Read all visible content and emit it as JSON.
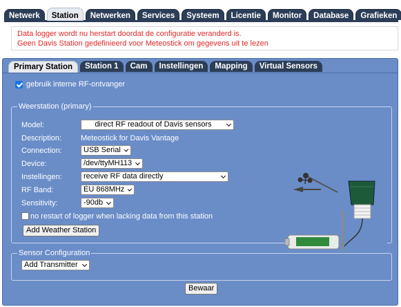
{
  "top_tabs": [
    {
      "label": "Netwerk",
      "active": false
    },
    {
      "label": "Station",
      "active": true
    },
    {
      "label": "Netwerken",
      "active": false
    },
    {
      "label": "Services",
      "active": false
    },
    {
      "label": "Systeem",
      "active": false
    },
    {
      "label": "Licentie",
      "active": false
    },
    {
      "label": "Monitor",
      "active": false
    },
    {
      "label": "Database",
      "active": false
    },
    {
      "label": "Grafieken",
      "active": false
    }
  ],
  "alert": {
    "line1": "Data logger wordt nu herstart doordat de configuratie veranderd is.",
    "line2": "Geen Davis Station gedefinieerd voor Meteostick om gegevens uit te lezen"
  },
  "sub_tabs": [
    {
      "label": "Primary Station",
      "active": true
    },
    {
      "label": "Station 1",
      "active": false
    },
    {
      "label": "Cam",
      "active": false
    },
    {
      "label": "Instellingen",
      "active": false
    },
    {
      "label": "Mapping",
      "active": false
    },
    {
      "label": "Virtual Sensors",
      "active": false
    }
  ],
  "rf_checkbox": {
    "label": "gebruik interne RF-ontvanger",
    "checked": true
  },
  "weather_station": {
    "legend": "Weerstation (primary)",
    "model": {
      "label": "Model:",
      "value": "direct RF readout of Davis sensors"
    },
    "description": {
      "label": "Description:",
      "value": "Meteostick for Davis Vantage"
    },
    "connection": {
      "label": "Connection:",
      "value": "USB Serial"
    },
    "device": {
      "label": "Device:",
      "value": "/dev/ttyMH113"
    },
    "instellingen": {
      "label": "Instellingen:",
      "value": "receive RF data directly"
    },
    "rf_band": {
      "label": "RF Band:",
      "value": "EU 868MHz"
    },
    "sensitivity": {
      "label": "Sensitivity:",
      "value": "-90db"
    },
    "no_restart": {
      "label": "no restart of logger when lacking data from this station",
      "checked": false
    },
    "add_button": "Add Weather Station"
  },
  "sensor_config": {
    "legend": "Sensor Configuration",
    "add_transmitter": "Add Transmitter"
  },
  "save_button": "Bewaar",
  "colors": {
    "tab_bg": "#2c3e57",
    "panel_bg": "#6a8dc8",
    "alert_text": "#e02828",
    "checkbox_accent": "#1a73e8"
  }
}
